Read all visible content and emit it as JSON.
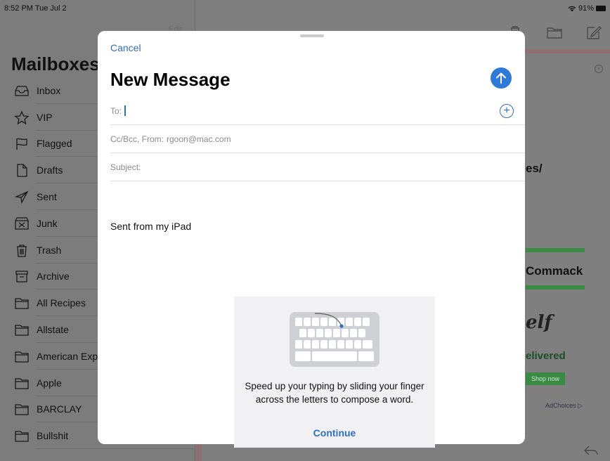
{
  "status_bar": {
    "time": "8:52 PM  Tue Jul 2",
    "battery": "91%"
  },
  "sidebar": {
    "edit_label": "Edit",
    "title": "Mailboxes",
    "items": [
      {
        "label": "Inbox",
        "icon": "inbox-icon"
      },
      {
        "label": "VIP",
        "icon": "star-icon"
      },
      {
        "label": "Flagged",
        "icon": "flag-icon"
      },
      {
        "label": "Drafts",
        "icon": "draft-icon"
      },
      {
        "label": "Sent",
        "icon": "send-icon"
      },
      {
        "label": "Junk",
        "icon": "junk-icon"
      },
      {
        "label": "Trash",
        "icon": "trash-icon"
      },
      {
        "label": "Archive",
        "icon": "archive-icon"
      },
      {
        "label": "All Recipes",
        "icon": "folder-icon"
      },
      {
        "label": "Allstate",
        "icon": "folder-icon"
      },
      {
        "label": "American Exp",
        "icon": "folder-icon"
      },
      {
        "label": "Apple",
        "icon": "folder-icon"
      },
      {
        "label": "BARCLAY",
        "icon": "folder-icon"
      },
      {
        "label": "Bullshit",
        "icon": "folder-icon"
      }
    ]
  },
  "background_message": {
    "fragment_1": "es/",
    "fragment_2": "Commack",
    "fragment_3": "elf",
    "fragment_4": "elivered",
    "shop_button": "Shop now",
    "adchoices": "AdChoices"
  },
  "compose": {
    "cancel_label": "Cancel",
    "title": "New Message",
    "to_label": "To:",
    "ccbcc_label": "Cc/Bcc, From:",
    "from_value": "rgoon@mac.com",
    "subject_label": "Subject:",
    "body_signature": "Sent from my iPad"
  },
  "tip": {
    "message": "Speed up your typing by sliding your finger across the letters to compose a word.",
    "continue_label": "Continue"
  },
  "colors": {
    "accent": "#2f7ad6",
    "link": "#2f6fbf",
    "overlay_gray": "#7d7d7d"
  }
}
